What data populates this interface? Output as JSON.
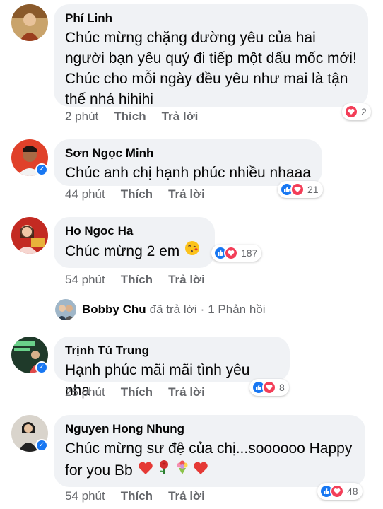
{
  "comments": [
    {
      "author": "Phí Linh",
      "text": "Chúc mừng chặng đường yêu của hai người bạn yêu quý đi tiếp một dấu mốc mới! Chúc cho mỗi ngày đều yêu như mai là tận thế nhá hihihi",
      "time": "2 phút",
      "like_label": "Thích",
      "reply_label": "Trả lời",
      "reaction_count": "2",
      "reactions": [
        "love-icon"
      ],
      "verified": false
    },
    {
      "author": "Sơn Ngọc Minh",
      "text": "Chúc anh chị hạnh phúc nhiều nhaaa",
      "time": "44 phút",
      "like_label": "Thích",
      "reply_label": "Trả lời",
      "reaction_count": "21",
      "reactions": [
        "like-icon",
        "love-icon"
      ],
      "verified": true
    },
    {
      "author": "Ho Ngoc Ha",
      "text": "Chúc mừng 2 em",
      "text_emoji": "kissing-heart-emoji",
      "time": "54 phút",
      "like_label": "Thích",
      "reply_label": "Trả lời",
      "reaction_count": "187",
      "reactions": [
        "like-icon",
        "love-icon"
      ],
      "verified": false,
      "reply_summary": {
        "name": "Bobby Chu",
        "action": "đã trả lời",
        "separator": "·",
        "count": "1 Phản hồi"
      }
    },
    {
      "author": "Trịnh Tú Trung",
      "text": "Hạnh phúc mãi mãi tình yêu nha",
      "time": "25 phút",
      "like_label": "Thích",
      "reply_label": "Trả lời",
      "reaction_count": "8",
      "reactions": [
        "like-icon",
        "love-icon"
      ],
      "verified": true
    },
    {
      "author": "Nguyen Hong Nhung",
      "text_line1": "Chúc mừng sư đệ của chị...soooooo Happy",
      "text_line2": "for you Bb",
      "text_emojis": [
        "red-heart-emoji",
        "rose-emoji",
        "bouquet-emoji",
        "red-heart-emoji"
      ],
      "time": "54 phút",
      "like_label": "Thích",
      "reply_label": "Trả lời",
      "reaction_count": "48",
      "reactions": [
        "like-icon",
        "love-icon"
      ],
      "verified": true
    }
  ],
  "colors": {
    "bubble": "#f0f2f5",
    "meta_text": "#65676b",
    "like_blue": "#1877f2",
    "love_red": "#f33e58"
  }
}
